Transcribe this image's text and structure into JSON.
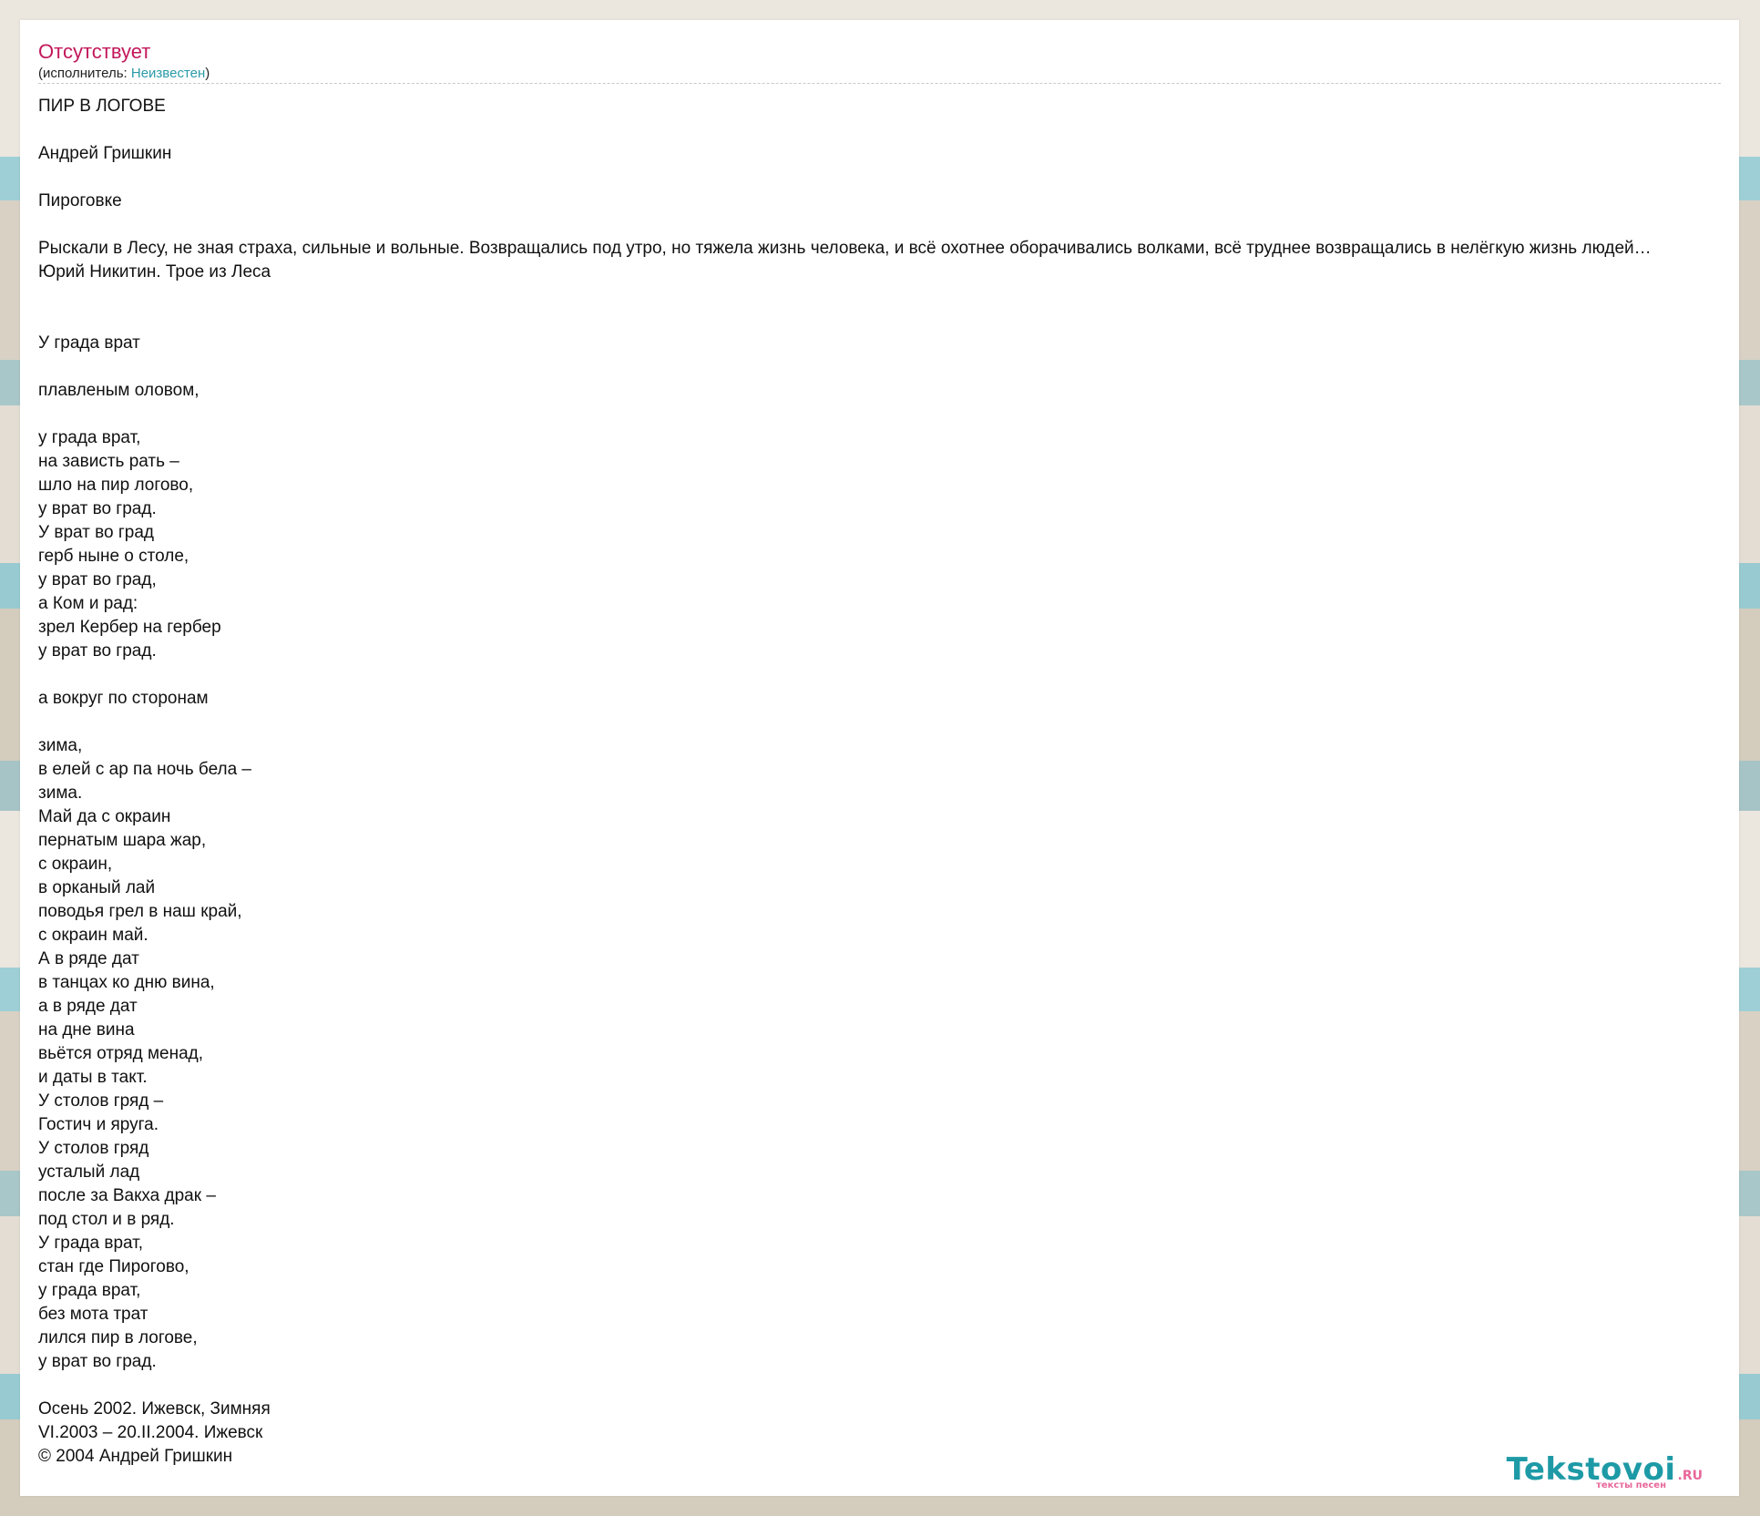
{
  "song": {
    "title": "Отсутствует",
    "artist_prefix": "(исполнитель: ",
    "artist_name": "Неизвестен",
    "artist_suffix": ")"
  },
  "lyrics": [
    "ПИР В ЛОГОВЕ",
    "",
    "Андрей Гришкин",
    "",
    "Пироговке",
    "",
    "Рыскали в Лесу, не зная страха, сильные и вольные. Возвращались под утро, но тяжела жизнь человека, и всё охотнее оборачивались волками, всё труднее возвращались в нелёгкую жизнь людей…",
    "Юрий Никитин. Трое из Леса",
    "",
    "",
    "У града врат",
    "",
    "плавленым оловом,",
    "",
    "у града врат,",
    "на зависть рать –",
    "шло на пир логово,",
    "у врат во град.",
    "У врат во град",
    "герб ныне о столе,",
    "у врат во град,",
    "а Ком и рад:",
    "зрел Кербер на гербер",
    "у врат во град.",
    "",
    "а вокруг по сторонам",
    "",
    "зима,",
    "в елей с ар па ночь бела –",
    "зима.",
    "Май да с окраин",
    "пернатым шара жар,",
    "с окраин,",
    "в орканый лай",
    "поводья грел в наш край,",
    "с окраин май.",
    "А в ряде дат",
    "в танцах ко дню вина,",
    "а в ряде дат",
    "на дне вина",
    "вьётся отряд менад,",
    "и даты в такт.",
    "У столов гряд –",
    "Гостич и яруга.",
    "У столов гряд",
    "усталый лад",
    "после за Вакха драк –",
    "под стол и в ряд.",
    "У града врат,",
    "стан где Пирогово,",
    "у града врат,",
    "без мота трат",
    "лился пир в логове,",
    "у врат во град.",
    "",
    "Осень 2002. Ижевск, Зимняя",
    "VI.2003 – 20.II.2004. Ижевск",
    "© 2004 Андрей Гришкин"
  ],
  "logo": {
    "main": "Tekstovoi",
    "tld": ".RU",
    "subtitle": "тексты песен"
  },
  "colors": {
    "title": "#c2185b",
    "link": "#2a9aa8",
    "logo_main": "#1d9aa6",
    "logo_accent": "#e8679a"
  }
}
